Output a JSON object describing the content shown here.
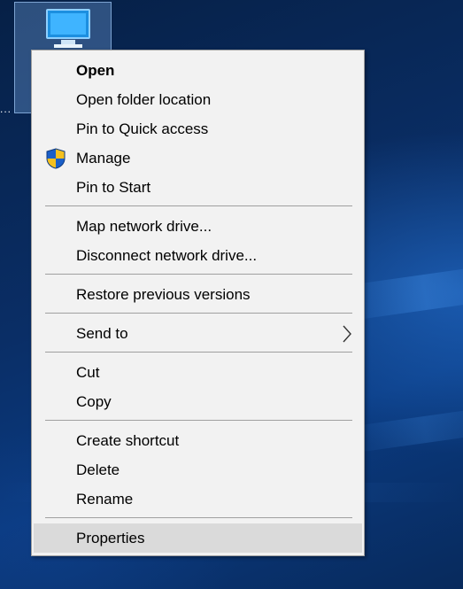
{
  "desktop": {
    "icon_ellipsis": "..."
  },
  "context_menu": {
    "items": [
      {
        "label": "Open"
      },
      {
        "label": "Open folder location"
      },
      {
        "label": "Pin to Quick access"
      },
      {
        "label": "Manage",
        "icon": "uac-shield-icon"
      },
      {
        "label": "Pin to Start"
      },
      {
        "label": "Map network drive..."
      },
      {
        "label": "Disconnect network drive..."
      },
      {
        "label": "Restore previous versions"
      },
      {
        "label": "Send to",
        "icon": "chevron-right-icon"
      },
      {
        "label": "Cut"
      },
      {
        "label": "Copy"
      },
      {
        "label": "Create shortcut"
      },
      {
        "label": "Delete"
      },
      {
        "label": "Rename"
      },
      {
        "label": "Properties"
      }
    ],
    "default_item": "Open",
    "highlighted_item": "Properties"
  },
  "colors": {
    "menu_background": "#f2f2f2",
    "highlight": "#dadada",
    "separator": "#a0a0a0",
    "desktop_accent": "#0a3a80"
  }
}
